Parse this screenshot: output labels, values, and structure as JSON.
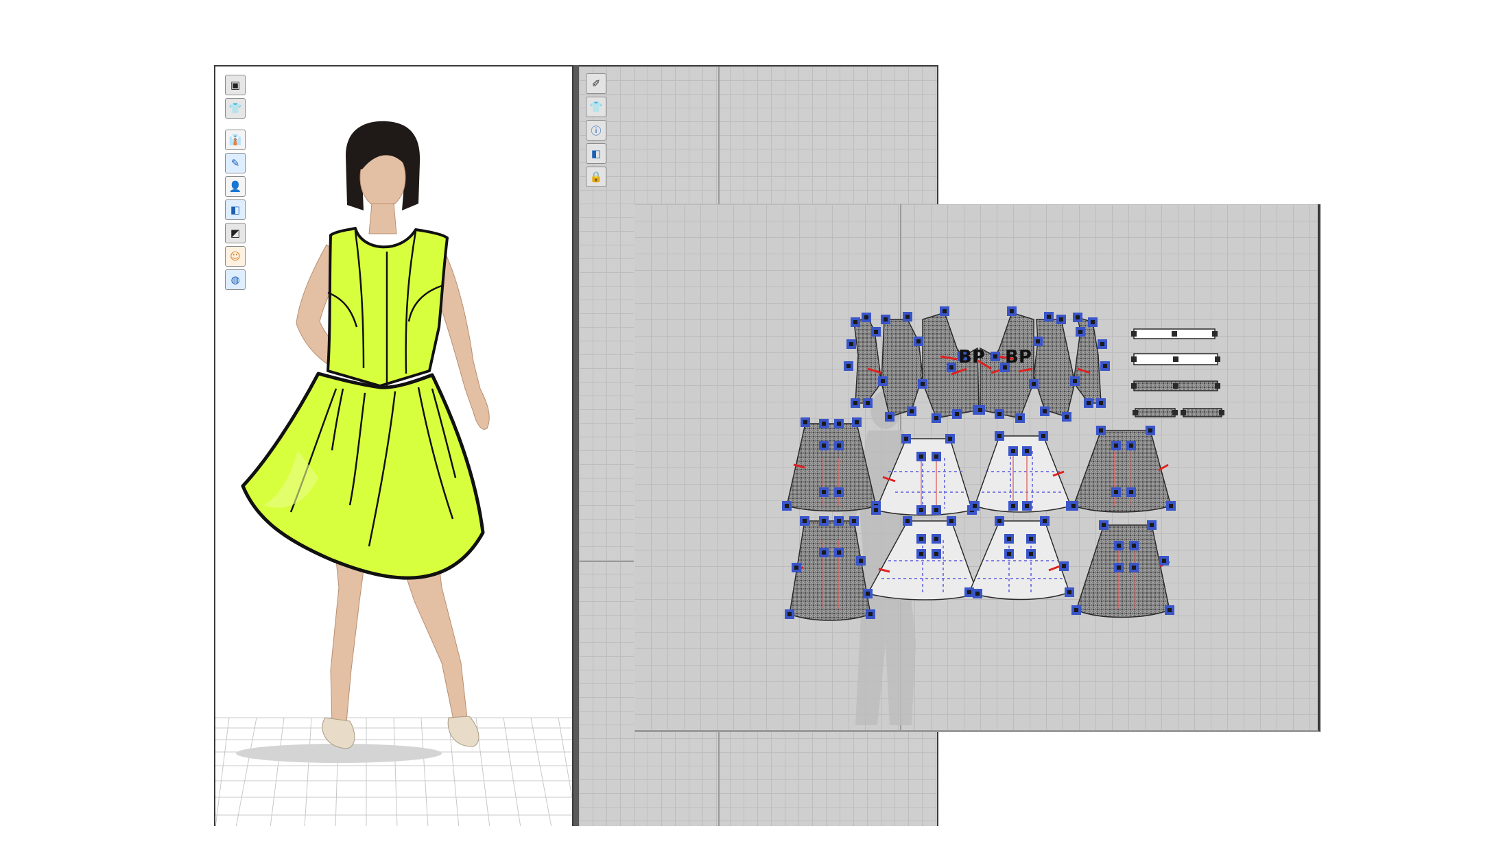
{
  "window": {
    "panels": [
      "3d-garment-view",
      "2d-pattern-view",
      "2d-pattern-zoom"
    ]
  },
  "colors": {
    "garment_fill": "#d8ff3d",
    "garment_outline": "#111111",
    "canvas_bg": "#cfcfcf",
    "control_point": "#3a55c8",
    "control_point_center": "#1a1a1a",
    "notch_mark": "#e02020",
    "pattern_fabric": "#8a8a8a",
    "pattern_light": "#ececec"
  },
  "toolbar_3d": {
    "tools": [
      {
        "icon": "avatar-display-icon",
        "glyph": "▣"
      },
      {
        "icon": "garment-display-icon",
        "glyph": "👕"
      },
      {
        "icon": "garment-shading-icon",
        "glyph": "👔"
      },
      {
        "icon": "show-pin-icon",
        "glyph": "✎"
      },
      {
        "icon": "avatar-visibility-icon",
        "glyph": "👤"
      },
      {
        "icon": "texture-display-icon",
        "glyph": "◧"
      },
      {
        "icon": "render-mode-icon",
        "glyph": "◩"
      },
      {
        "icon": "avatar-skin-icon",
        "glyph": "☺"
      },
      {
        "icon": "environment-globe-icon",
        "glyph": "◍"
      }
    ]
  },
  "toolbar_2d": {
    "tools": [
      {
        "icon": "show-seam-icon",
        "glyph": "✐"
      },
      {
        "icon": "pattern-display-icon",
        "glyph": "👕"
      },
      {
        "icon": "info-icon",
        "glyph": "ⓘ"
      },
      {
        "icon": "texture-2d-icon",
        "glyph": "◧"
      },
      {
        "icon": "lock-pattern-icon",
        "glyph": "🔒"
      }
    ]
  },
  "pattern_labels": {
    "bust_point_left": "BP",
    "bust_point_right": "BP"
  }
}
